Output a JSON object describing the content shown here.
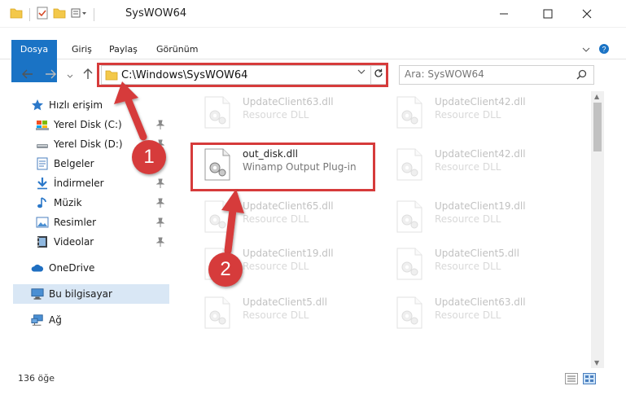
{
  "window": {
    "title": "SysWOW64"
  },
  "ribbon": {
    "tabs": [
      "Dosya",
      "Giriş",
      "Paylaş",
      "Görünüm"
    ]
  },
  "address": {
    "path": "C:\\Windows\\SysWOW64"
  },
  "search": {
    "placeholder": "Ara: SysWOW64"
  },
  "nav": {
    "quick_access": "Hızlı erişim",
    "items": [
      "Yerel Disk (C:)",
      "Yerel Disk (D:)",
      "Belgeler",
      "İndirmeler",
      "Müzik",
      "Resimler",
      "Videolar"
    ],
    "onedrive": "OneDrive",
    "this_pc": "Bu bilgisayar",
    "network": "Ağ"
  },
  "files": {
    "highlighted": {
      "name": "out_disk.dll",
      "type": "Winamp Output Plug-in"
    },
    "faded": [
      {
        "name": "UpdateClient63.dll",
        "type": "Resource DLL"
      },
      {
        "name": "UpdateClient42.dll",
        "type": "Resource DLL"
      },
      {
        "name": "UpdateClient42.dll",
        "type": "Resource DLL"
      },
      {
        "name": "UpdateClient65.dll",
        "type": "Resource DLL"
      },
      {
        "name": "UpdateClient19.dll",
        "type": "Resource DLL"
      },
      {
        "name": "UpdateClient19.dll",
        "type": "Resource DLL"
      },
      {
        "name": "UpdateClient5.dll",
        "type": "Resource DLL"
      },
      {
        "name": "UpdateClient5.dll",
        "type": "Resource DLL"
      },
      {
        "name": "UpdateClient63.dll",
        "type": "Resource DLL"
      }
    ]
  },
  "status": {
    "count": "136 öğe"
  },
  "annotations": {
    "step1": "1",
    "step2": "2"
  },
  "colors": {
    "accent": "#1a73c5",
    "highlight": "#d63b3b",
    "selected": "#d9e7f5"
  },
  "icons": [
    "folder-icon",
    "back-icon",
    "forward-icon",
    "up-icon",
    "refresh-icon",
    "search-icon",
    "star-icon",
    "drive-icon",
    "document-icon",
    "download-icon",
    "music-icon",
    "pictures-icon",
    "videos-icon",
    "onedrive-icon",
    "computer-icon",
    "network-icon",
    "pin-icon",
    "dll-file-icon"
  ]
}
